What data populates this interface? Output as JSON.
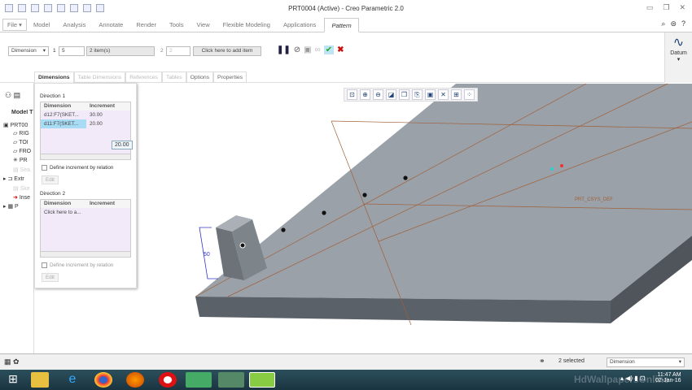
{
  "window": {
    "title": "PRT0004 (Active) - Creo Parametric 2.0"
  },
  "menu": [
    "File",
    "Model",
    "Analysis",
    "Annotate",
    "Render",
    "Tools",
    "View",
    "Flexible Modeling",
    "Applications",
    "Pattern"
  ],
  "ribbon": {
    "type": "Dimension",
    "dir1_label": "1",
    "dir1_count": "5",
    "dir1_items": "2 item(s)",
    "dir2_label": "2",
    "dir2_count": "2",
    "dir2_add": "Click here to add item",
    "datum": "Datum"
  },
  "tabs": [
    "Dimensions",
    "Table Dimensions",
    "References",
    "Tables",
    "Options",
    "Properties"
  ],
  "panel": {
    "dir1": {
      "title": "Direction 1",
      "headers": [
        "Dimension",
        "Increment"
      ],
      "rows": [
        [
          "d12:F7(SKET...",
          "30.00"
        ],
        [
          "d11:F7(SKET...",
          "20.00"
        ]
      ],
      "tooltip": "20.00",
      "relation": "Define increment by relation",
      "edit": "Edit"
    },
    "dir2": {
      "title": "Direction 2",
      "headers": [
        "Dimension",
        "Increment"
      ],
      "placeholder": "Click here to a...",
      "relation": "Define increment by relation",
      "edit": "Edit"
    }
  },
  "tree": {
    "header": "Model T",
    "items": [
      "PRT00",
      "RIG",
      "TOI",
      "FRO",
      "PR",
      "Sea",
      "Extr",
      "Ske",
      "Inse",
      "P"
    ]
  },
  "model": {
    "dimension": "50",
    "csys": "PRT_CSYS_DEF"
  },
  "status": {
    "selected": "2 selected",
    "filter": "Dimension"
  },
  "clock": {
    "time": "11:47 AM",
    "date": "02-Jan-16"
  },
  "watermark": "HdWallpapersOnline"
}
